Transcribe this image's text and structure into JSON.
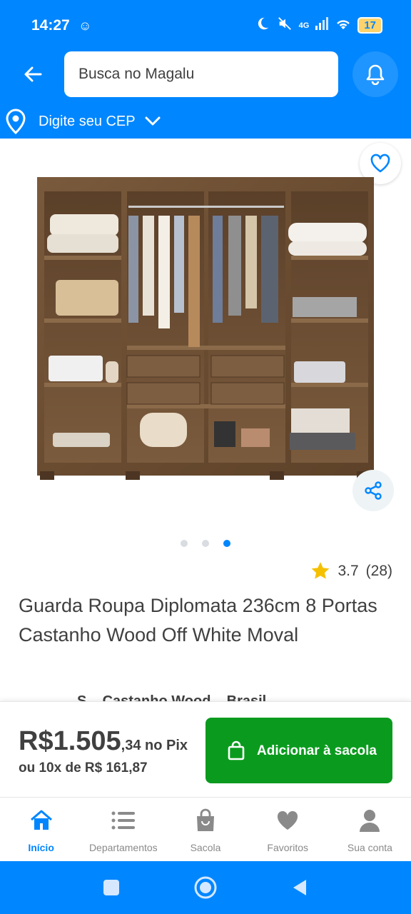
{
  "status": {
    "time": "14:27",
    "time_badge": "☺",
    "network": "4G",
    "battery": "17"
  },
  "header": {
    "search_placeholder": "Busca no Magalu",
    "cep_label": "Digite seu CEP"
  },
  "gallery": {
    "total": 3,
    "active_index": 2
  },
  "product": {
    "rating": "3.7",
    "reviews": "(28)",
    "title": "Guarda Roupa Diplomata 236cm 8 Portas Castanho Wood Off White Moval",
    "cut_text": "S... Castanho Wood... Brasil..."
  },
  "price": {
    "main": "R$1.505",
    "cents": ",34",
    "pix_label": " no Pix",
    "installments": "ou 10x de R$ 161,87"
  },
  "add_button": {
    "label": "Adicionar à sacola"
  },
  "bottom_nav": {
    "items": [
      {
        "label": "Início",
        "icon": "home-icon"
      },
      {
        "label": "Departamentos",
        "icon": "menu-list-icon"
      },
      {
        "label": "Sacola",
        "icon": "bag-icon"
      },
      {
        "label": "Favoritos",
        "icon": "heart-icon"
      },
      {
        "label": "Sua conta",
        "icon": "user-icon"
      }
    ]
  },
  "colors": {
    "brand_blue": "#0086ff",
    "buy_green": "#0a9b1e",
    "star_yellow": "#f5c000",
    "text": "#404040"
  }
}
